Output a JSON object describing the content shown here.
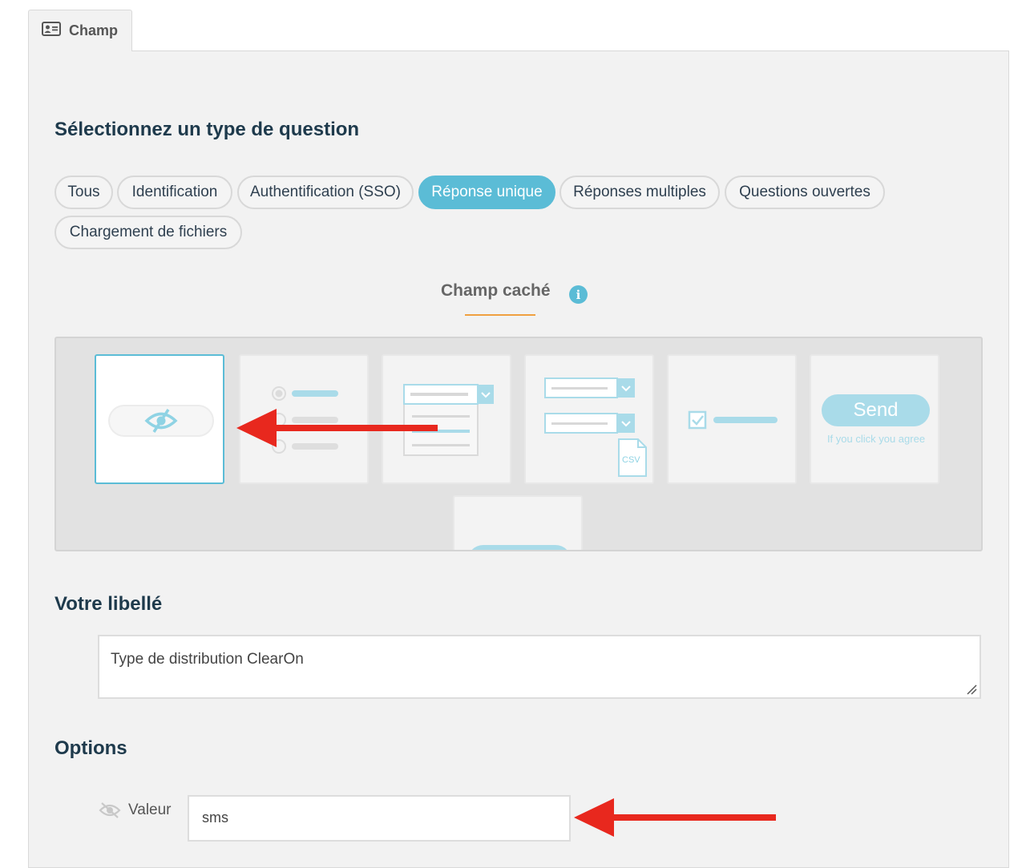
{
  "tab": {
    "label": "Champ",
    "icon": "id-card-icon"
  },
  "section_question_type": {
    "title": "Sélectionnez un type de question"
  },
  "filters": [
    {
      "label": "Tous",
      "active": false
    },
    {
      "label": "Identification",
      "active": false
    },
    {
      "label": "Authentification (SSO)",
      "active": false
    },
    {
      "label": "Réponse unique",
      "active": true
    },
    {
      "label": "Réponses multiples",
      "active": false
    },
    {
      "label": "Questions ouvertes",
      "active": false
    },
    {
      "label": "Chargement de fichiers",
      "active": false
    }
  ],
  "selected_type": {
    "title": "Champ caché",
    "info_icon": "info-icon"
  },
  "cards": [
    {
      "kind": "hidden-field",
      "selected": true
    },
    {
      "kind": "radio-list",
      "selected": false
    },
    {
      "kind": "dropdown-list",
      "selected": false
    },
    {
      "kind": "dropdown-csv",
      "selected": false,
      "badge": "CSV"
    },
    {
      "kind": "checkbox",
      "selected": false
    },
    {
      "kind": "send-button",
      "selected": false,
      "button_label": "Send",
      "caption": "If you click you agree"
    },
    {
      "kind": "button",
      "selected": false
    }
  ],
  "section_label": {
    "title": "Votre libellé",
    "value": "Type de distribution ClearOn"
  },
  "section_options": {
    "title": "Options",
    "field_label": "Valeur",
    "field_icon": "eye-slash-icon",
    "field_value": "sms"
  },
  "colors": {
    "accent": "#5bbcd6",
    "heading": "#1e3a4c",
    "arrow": "#e8281e",
    "underline": "#f0a040"
  }
}
